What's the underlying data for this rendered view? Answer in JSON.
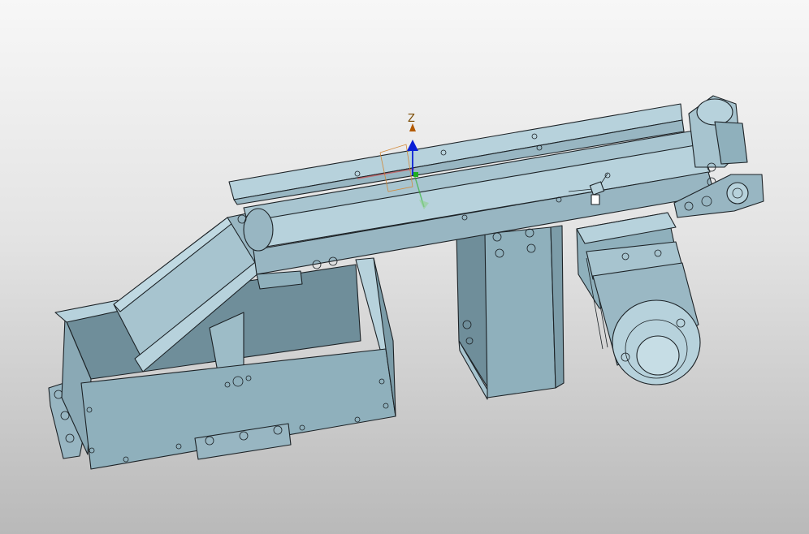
{
  "viewport": {
    "background_top": "#f7f7f7",
    "background_bottom": "#b9b9b9"
  },
  "model": {
    "face_light": "#b7d2dc",
    "face_mid": "#98b6c2",
    "face_dark": "#6f8e9a",
    "edge": "#1c2226"
  },
  "triad": {
    "z_label": "Z",
    "z_color": "#0a1fd6",
    "label_color": "#7a4a00",
    "x_color": "#d23a3a",
    "y_color": "#21b021"
  }
}
